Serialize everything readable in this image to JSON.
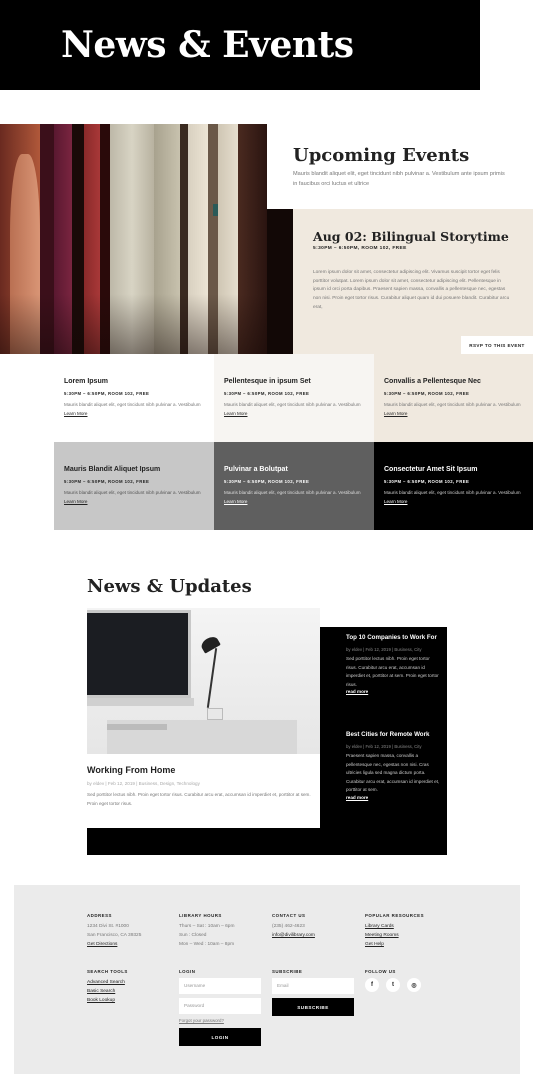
{
  "hero": {
    "title": "News & Events"
  },
  "upcoming": {
    "title": "Upcoming Events",
    "description": "Mauris blandit aliquet elit, eget tincidunt nibh pulvinar a. Vestibulum ante ipsum primis in faucibus orci luctus et ultrice"
  },
  "feature": {
    "title": "Aug 02: Bilingual Storytime",
    "meta": "5:30PM – 6:50PM, ROOM 102, FREE",
    "description": "Lorem ipsum dolor sit amet, consectetur adipiscing elit. Vivamus suscipit tortor eget felis porttitor volutpat. Lorem ipsum dolor sit amet, consectetur adipiscing elit. Pellentesque in ipsum id orci porta dapibus. Praesent sapien massa, convallis a pellentesque nec, egestas non nisi. Proin eget tortor risus. Curabitur aliquet quam id dui posuere blandit. Curabitur arcu erat,",
    "rsvp_label": "RSVP TO THIS EVENT"
  },
  "events": [
    {
      "title": "Lorem Ipsum",
      "meta": "5:30PM – 6:50PM, ROOM 102, FREE",
      "desc": "Mauris blandit aliquet elit, eget tincidunt nibh pulvinar a. Vestibulum",
      "link": "Learn More"
    },
    {
      "title": "Pellentesque in ipsum Set",
      "meta": "5:30PM – 6:50PM, ROOM 102, FREE",
      "desc": "Mauris blandit aliquet elit, eget tincidunt nibh pulvinar a. Vestibulum",
      "link": "Learn More"
    },
    {
      "title": "Convallis a Pellentesque Nec",
      "meta": "5:30PM – 6:50PM, ROOM 102, FREE",
      "desc": "Mauris blandit aliquet elit, eget tincidunt nibh pulvinar a. Vestibulum",
      "link": "Learn More"
    },
    {
      "title": "Mauris Blandit Aliquet Ipsum",
      "meta": "5:30PM – 6:50PM, ROOM 102, FREE",
      "desc": "Mauris blandit aliquet elit, eget tincidunt nibh pulvinar a. Vestibulum",
      "link": "Learn More"
    },
    {
      "title": "Pulvinar a Bolutpat",
      "meta": "5:30PM – 6:50PM, ROOM 102, FREE",
      "desc": "Mauris blandit aliquet elit, eget tincidunt nibh pulvinar a. Vestibulum",
      "link": "Learn More"
    },
    {
      "title": "Consectetur Amet Sit Ipsum",
      "meta": "5:30PM – 6:50PM, ROOM 102, FREE",
      "desc": "Mauris blandit aliquet elit, eget tincidunt nibh pulvinar a. Vestibulum",
      "link": "Learn More"
    }
  ],
  "news": {
    "title": "News & Updates",
    "main": {
      "title": "Working From Home",
      "meta": "by eldev | Feb 12, 2019 | Business, Design, Technology",
      "desc": "Sed porttitor lectus nibh. Proin eget tortor risus. Curabitur arcu erat, accumsan id imperdiet et, porttitor at sem. Proin eget tortor risus."
    },
    "side": [
      {
        "title": "Top 10 Companies to Work For",
        "meta": "by eldev | Feb 12, 2019 | Business, City",
        "desc": "Sed porttitor lectus nibh. Proin eget tortor risus. Curabitur arcu erat, accumsan id imperdiet et, porttitor at sem. Proin eget tortor risus.",
        "link": "read more"
      },
      {
        "title": "Best Cities for Remote Work",
        "meta": "by eldev | Feb 12, 2019 | Business, City",
        "desc": "Praesent sapien massa, convallis a pellentesque nec, egestas non nisi. Cras ultricies ligula sed magna dictum porta. Curabitur arcu erat, accumsan id imperdiet et, porttitor at sem.",
        "link": "read more"
      }
    ]
  },
  "footer": {
    "address": {
      "heading": "ADDRESS",
      "line1": "1234 Divi St. #1000",
      "line2": "San Francisco, CA 39325",
      "link": "Get Directions"
    },
    "hours": {
      "heading": "LIBRARY HOURS",
      "line1": "Thurs – Sat : 10am – 6pm",
      "line2": "Sun : Closed",
      "line3": "Mon – Wed : 10am – 8pm"
    },
    "contact": {
      "heading": "CONTACT US",
      "phone": "(235) 462-4623",
      "email": "info@divilibrary.com"
    },
    "resources": {
      "heading": "POPULAR RESOURCES",
      "items": [
        "Library Cards",
        "Meeting Rooms",
        "Get Help"
      ]
    },
    "tools": {
      "heading": "SEARCH TOOLS",
      "items": [
        "Advanced Search",
        "Basic Search",
        "Book Lookup"
      ]
    },
    "login": {
      "heading": "LOGIN",
      "username_placeholder": "Username",
      "password_placeholder": "Password",
      "forgot": "Forgot your password?",
      "button": "LOGIN"
    },
    "subscribe": {
      "heading": "SUBSCRIBE",
      "email_placeholder": "Email",
      "button": "SUBSCRIBE"
    },
    "follow": {
      "heading": "FOLLOW US",
      "icons": [
        "f",
        "t",
        "◎"
      ]
    }
  },
  "colors": {
    "beige": "#f0e9df",
    "light_gray": "#f7f5f2",
    "mid_gray": "#c7c7c7",
    "dark_gray": "#5f5f5f",
    "black": "#000000",
    "footer_bg": "#ebebeb"
  }
}
